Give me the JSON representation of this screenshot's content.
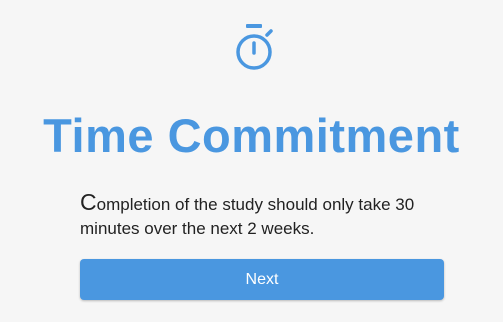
{
  "icon": "timer-icon",
  "colors": {
    "accent": "#4a97e0",
    "background": "#f6f6f6",
    "text": "#222222",
    "button_text": "#ffffff"
  },
  "page": {
    "title": "Time Commitment",
    "description_first_letter": "C",
    "description_rest": "ompletion of the study should only take 30 minutes over the next 2 weeks."
  },
  "next_button": {
    "label": "Next"
  }
}
